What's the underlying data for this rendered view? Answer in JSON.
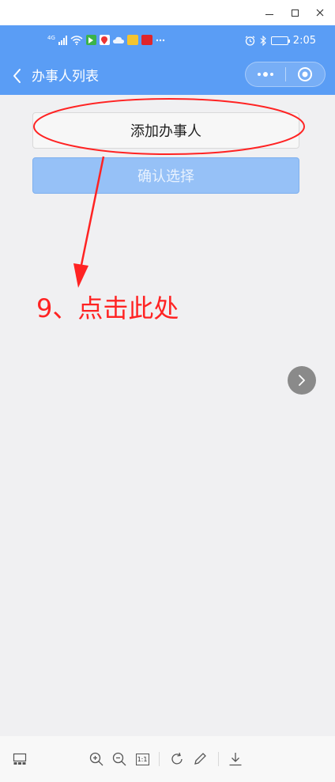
{
  "status_bar": {
    "network": "4G",
    "time": "2:05"
  },
  "nav": {
    "title": "办事人列表"
  },
  "buttons": {
    "add_label": "添加办事人",
    "confirm_label": "确认选择"
  },
  "annotation": {
    "text": "9、点击此处",
    "color": "#ff2323"
  },
  "toolbar": {
    "ratio_label": "1:1"
  },
  "colors": {
    "header": "#5a9df5",
    "confirm_button": "#96c1f7"
  }
}
